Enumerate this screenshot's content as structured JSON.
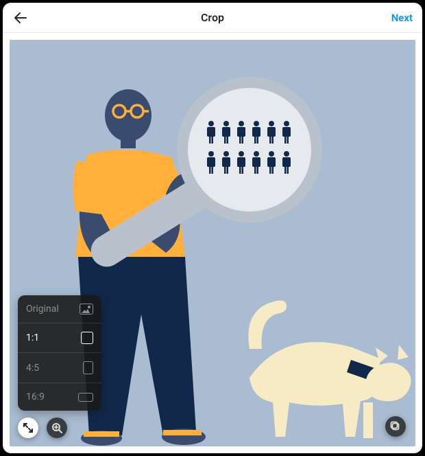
{
  "header": {
    "title": "Crop",
    "next_label": "Next"
  },
  "ratio_panel": {
    "items": [
      {
        "label": "Original",
        "shape": "orig",
        "dim": true
      },
      {
        "label": "1:1",
        "shape": "11",
        "dim": false,
        "selected": true
      },
      {
        "label": "4:5",
        "shape": "45",
        "dim": true
      },
      {
        "label": "16:9",
        "shape": "169",
        "dim": true
      }
    ]
  },
  "icons": {
    "back": "back-arrow-icon",
    "expand": "expand-icon",
    "zoom": "zoom-icon",
    "multi": "multi-select-icon"
  },
  "colors": {
    "accent": "#0095f6",
    "canvas_bg": "#A9BCD1",
    "panel_bg": "rgba(26,26,26,0.9)"
  },
  "illustration": {
    "description": "Person holding a large magnifying glass showing rows of small person icons, with a cat walking beside them",
    "palette": {
      "skin": "#394C6F",
      "shirt": "#FFB03B",
      "pants": "#12284B",
      "glass_rim": "#12284B",
      "glass_fill": "#E6E9EE",
      "cat_body": "#F7EBC6",
      "cat_collar": "#12284B"
    }
  }
}
